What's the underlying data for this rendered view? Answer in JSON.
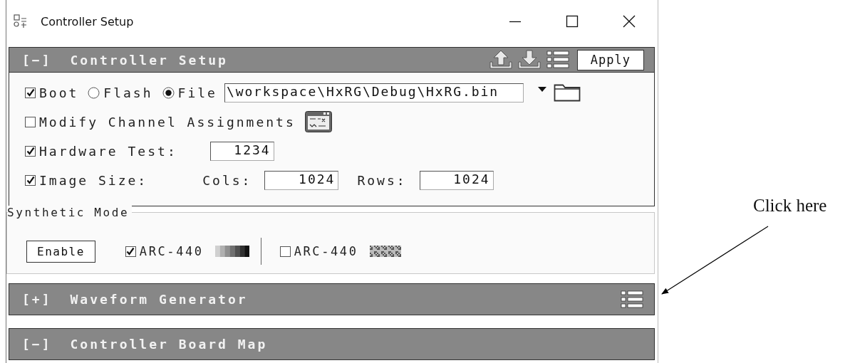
{
  "window": {
    "title": "Controller Setup"
  },
  "controller_setup": {
    "toggle": "[−]",
    "title": "Controller Setup",
    "apply_button": "Apply",
    "boot": {
      "label": "Boot",
      "checked": true
    },
    "source_options": [
      {
        "label": "Flash",
        "selected": false
      },
      {
        "label": "File",
        "selected": true
      }
    ],
    "file_path": "\\workspace\\HxRG\\Debug\\HxRG.bin",
    "modify_channels": {
      "label": "Modify Channel Assignments",
      "checked": false
    },
    "hardware_test": {
      "label": "Hardware Test:",
      "checked": true,
      "value": "1234"
    },
    "image_size": {
      "label": "Image Size:",
      "checked": true,
      "cols_label": "Cols:",
      "cols": "1024",
      "rows_label": "Rows:",
      "rows": "1024"
    }
  },
  "synthetic_mode": {
    "title": "Synthetic Mode",
    "enable_button": "Enable",
    "patterns": [
      {
        "label": "ARC-440",
        "checked": true,
        "kind": "gradient"
      },
      {
        "label": "ARC-440",
        "checked": false,
        "kind": "noise"
      }
    ]
  },
  "sections": [
    {
      "toggle": "[+]",
      "title": "Waveform Generator",
      "list_icon": true
    },
    {
      "toggle": "[−]",
      "title": "Controller Board Map",
      "list_icon": false
    }
  ],
  "annotation": {
    "text": "Click here"
  }
}
